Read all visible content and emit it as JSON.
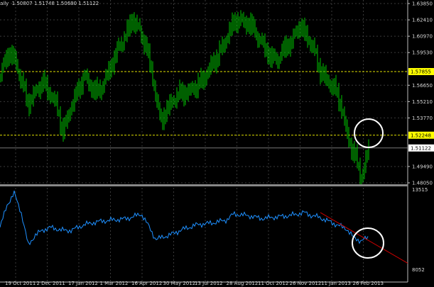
{
  "header": {
    "symbol_fragment": "aily",
    "ohlc": "1.50807 1.51748 1.50680 1.51122"
  },
  "colors": {
    "background": "#000000",
    "bars": "#00c000",
    "indicator": "#1e90ff",
    "level_line": "#e0e000",
    "level_label_bg": "#ffff00",
    "trend_line": "#cc0000",
    "annotation_circle": "#ffffff",
    "grid": "#3a3a3a"
  },
  "chart_data": [
    {
      "type": "bar",
      "subtype": "ohlc-price",
      "ylim": [
        1.4805,
        1.6385
      ],
      "yticks": [
        "1.63850",
        "1.62410",
        "1.60970",
        "1.59530",
        "1.56650",
        "1.55210",
        "1.53770",
        "1.49490",
        "1.48050"
      ],
      "levels": [
        {
          "value": 1.57855,
          "label": "1.57855"
        },
        {
          "value": 1.52248,
          "label": "1.52248"
        }
      ],
      "current_price": {
        "value": 1.51122,
        "label": "1.51122"
      },
      "closes": [
        1.575,
        1.595,
        1.59,
        1.57,
        1.55,
        1.56,
        1.57,
        1.56,
        1.55,
        1.525,
        1.545,
        1.56,
        1.575,
        1.565,
        1.56,
        1.57,
        1.585,
        1.6,
        1.61,
        1.625,
        1.615,
        1.6,
        1.57,
        1.535,
        1.545,
        1.555,
        1.56,
        1.56,
        1.565,
        1.57,
        1.58,
        1.59,
        1.6,
        1.615,
        1.625,
        1.622,
        1.62,
        1.61,
        1.6,
        1.59,
        1.59,
        1.6,
        1.605,
        1.62,
        1.61,
        1.6,
        1.58,
        1.57,
        1.565,
        1.55,
        1.52,
        1.505,
        1.485,
        1.51
      ],
      "grid": true
    },
    {
      "type": "line",
      "subtype": "indicator",
      "ylim": [
        8052,
        13515
      ],
      "yticks": [
        "13515",
        "8052"
      ],
      "values": [
        11000,
        12500,
        13300,
        12000,
        9800,
        10500,
        10800,
        11000,
        10900,
        10800,
        10800,
        11000,
        11200,
        11300,
        11400,
        11450,
        11500,
        11550,
        11600,
        11750,
        11900,
        11100,
        10200,
        10350,
        10500,
        10700,
        10900,
        11050,
        11200,
        11250,
        11300,
        11400,
        11500,
        11900,
        11850,
        11800,
        11700,
        11600,
        11650,
        11700,
        11750,
        11800,
        11900,
        12000,
        11800,
        11700,
        11500,
        11300,
        11100,
        10900,
        10300,
        10100,
        10300
      ],
      "trend_line": {
        "from": [
          "11 Jan 2013",
          12000
        ],
        "to": [
          "after 26 Feb 2013",
          8600
        ]
      },
      "grid": true
    }
  ],
  "x_axis": {
    "ticks": [
      "19 Oct 2011",
      "2 Dec 2011",
      "17 Jan 2012",
      "1 Mar 2012",
      "16 Apr 2012",
      "30 May 2012",
      "13 Jul 2012",
      "28 Aug 2012",
      "11 Oct 2012",
      "26 Nov 2012",
      "11 Jan 2013",
      "26 Feb 2013"
    ]
  }
}
